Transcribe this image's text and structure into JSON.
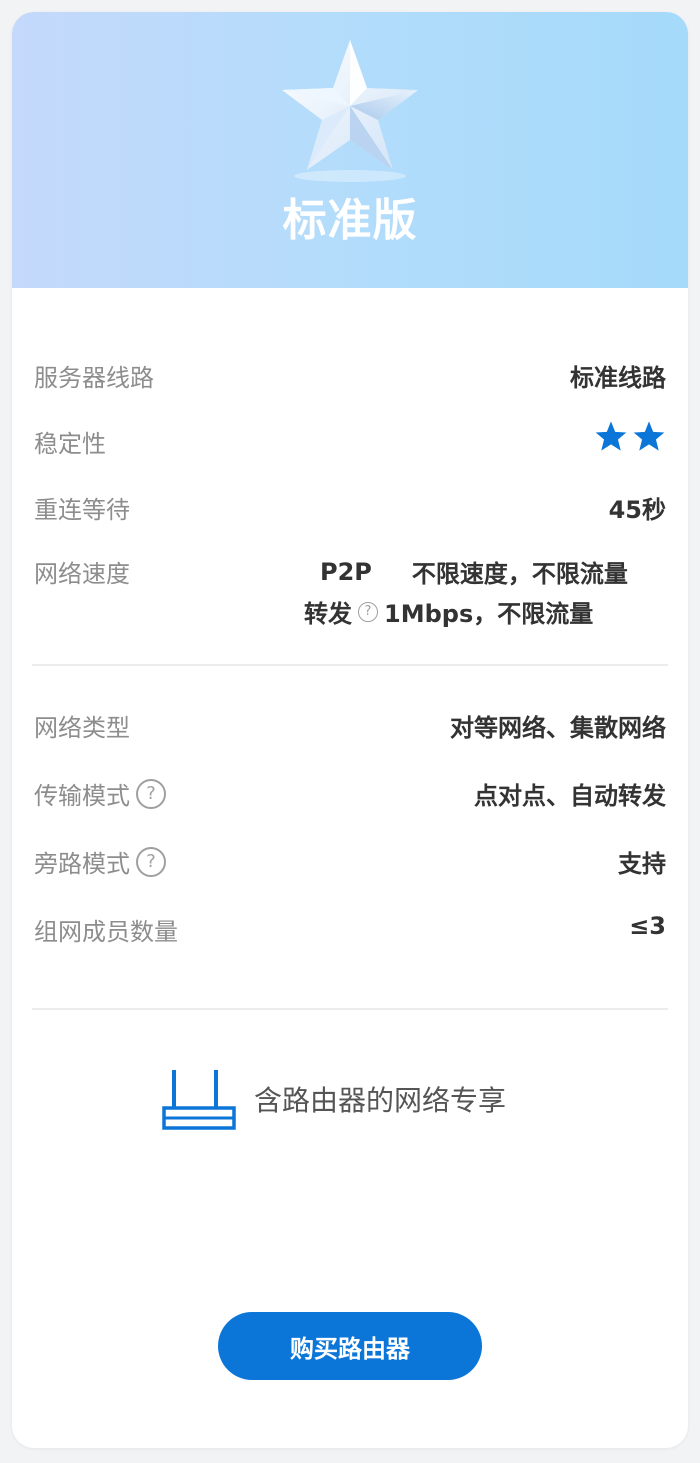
{
  "plan": {
    "title": "标准版",
    "icon": "star-icon"
  },
  "specs_section1": {
    "server_line": {
      "label": "服务器线路",
      "value": "标准线路"
    },
    "stability": {
      "label": "稳定性",
      "rating": 2,
      "max_visible": 2,
      "star_color": "#0c76d8"
    },
    "reconnect": {
      "label": "重连等待",
      "value": "45秒"
    },
    "speed": {
      "label": "网络速度",
      "p2p_name": "P2P",
      "p2p_value": "不限速度，不限流量",
      "relay_name": "转发",
      "relay_value": "1Mbps，不限流量"
    }
  },
  "specs_section2": {
    "network_type": {
      "label": "网络类型",
      "value": "对等网络、集散网络"
    },
    "transfer_mode": {
      "label": "传输模式",
      "value": "点对点、自动转发"
    },
    "bypass_mode": {
      "label": "旁路模式",
      "value": "支持"
    },
    "members": {
      "label": "组网成员数量",
      "value": "≤3"
    }
  },
  "router": {
    "icon": "router-icon",
    "text": "含路由器的网络专享"
  },
  "buy_button": {
    "label": "购买路由器",
    "color": "#0c76d8"
  },
  "help_glyph": "?"
}
